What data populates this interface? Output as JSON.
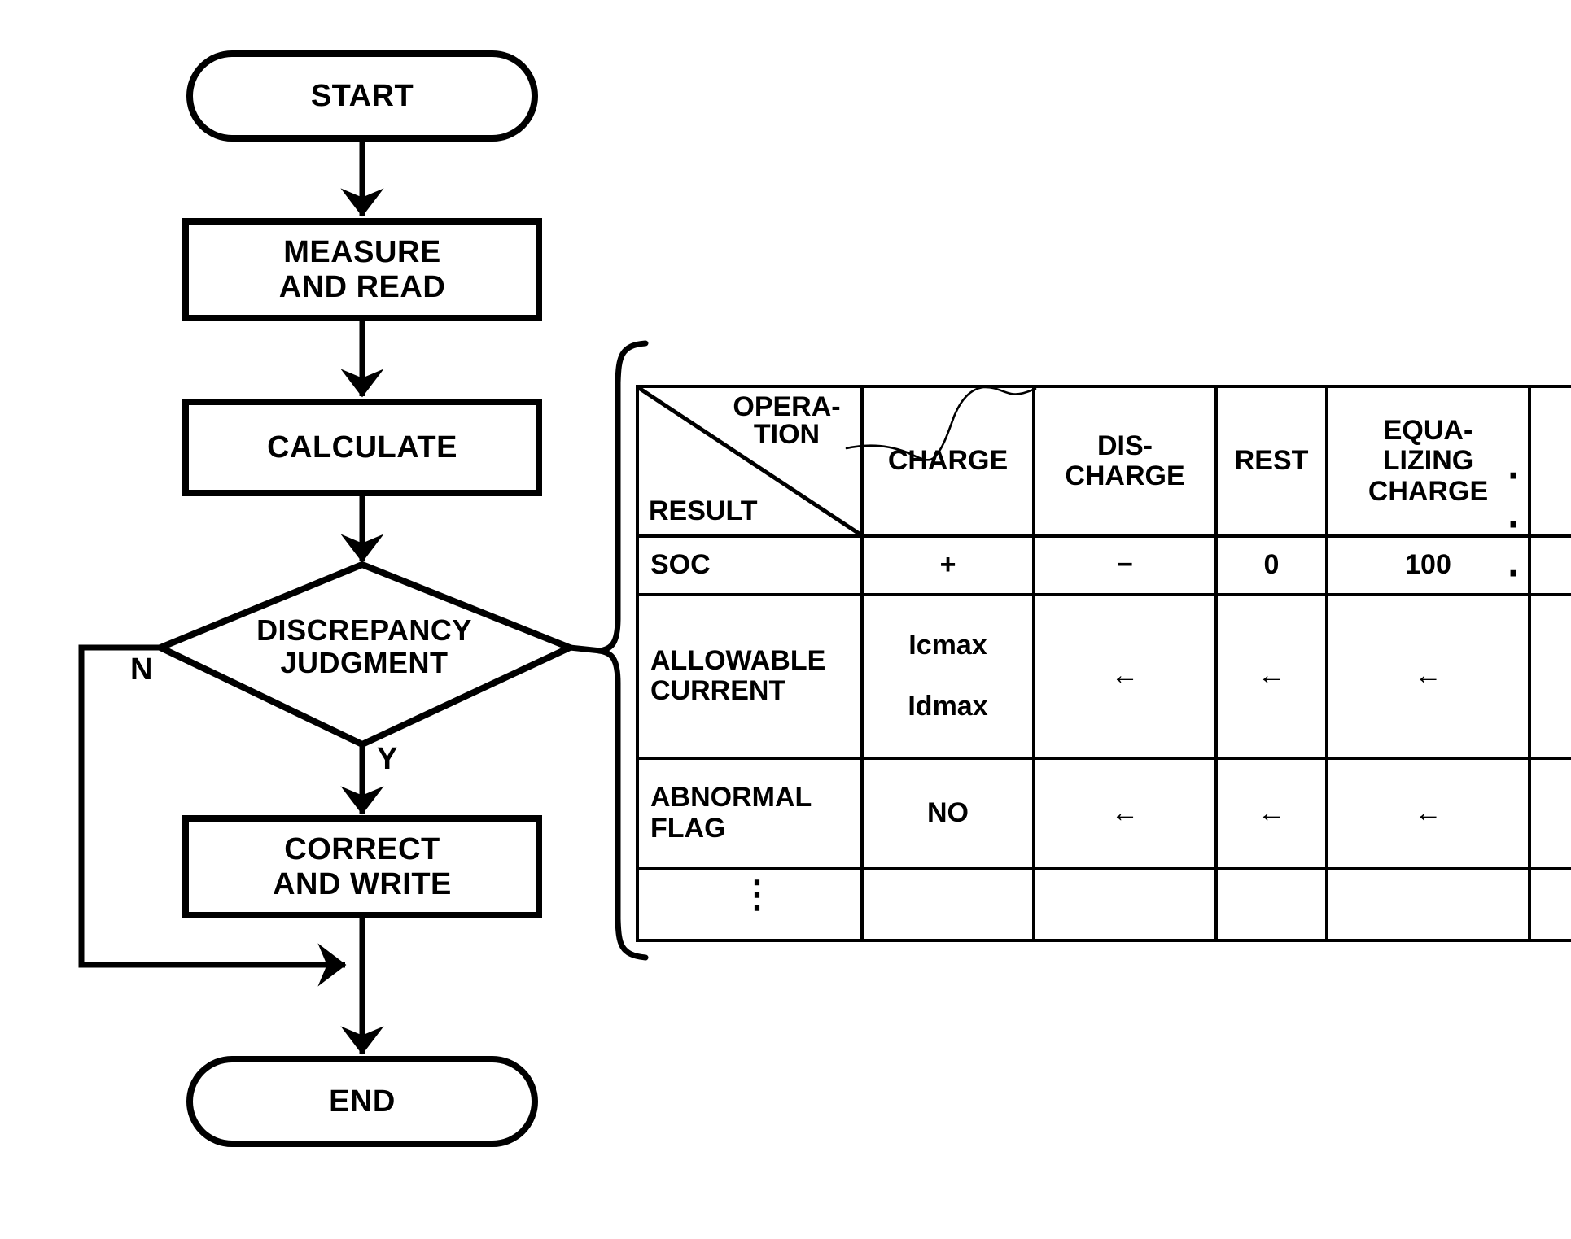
{
  "diagram": {
    "type": "flowchart-with-table",
    "flow": {
      "nodes": [
        {
          "id": "start",
          "shape": "terminal",
          "label": "START"
        },
        {
          "id": "measure",
          "shape": "process",
          "label": "MEASURE\nAND READ"
        },
        {
          "id": "calculate",
          "shape": "process",
          "label": "CALCULATE"
        },
        {
          "id": "judgment",
          "shape": "decision",
          "label": "DISCREPANCY\nJUDGMENT"
        },
        {
          "id": "correct",
          "shape": "process",
          "label": "CORRECT\nAND WRITE"
        },
        {
          "id": "end",
          "shape": "terminal",
          "label": "END"
        }
      ],
      "branch_labels": {
        "no": "N",
        "yes": "Y"
      }
    },
    "table": {
      "corner": {
        "column_axis_label": "OPERA-\nTION",
        "row_axis_label": "RESULT"
      },
      "columns": [
        {
          "key": "charge",
          "label": "CHARGE"
        },
        {
          "key": "dis",
          "label": "DIS-\nCHARGE"
        },
        {
          "key": "rest",
          "label": "REST"
        },
        {
          "key": "equal",
          "label": "EQUA-\nLIZING\nCHARGE"
        },
        {
          "key": "more",
          "label": ""
        }
      ],
      "columns_continuation": "· · ·",
      "rows": [
        {
          "label": "SOC",
          "cells": [
            "+",
            "−",
            "0",
            "100",
            ""
          ]
        },
        {
          "label": "ALLOWABLE\nCURRENT",
          "cells": [
            "Icmax\n\nIdmax",
            "←",
            "←",
            "←",
            ""
          ]
        },
        {
          "label": "ABNORMAL\nFLAG",
          "cells": [
            "NO",
            "←",
            "←",
            "←",
            ""
          ]
        },
        {
          "label": "",
          "cells": [
            "",
            "",
            "",
            "",
            ""
          ]
        }
      ],
      "rows_continuation": "⋮"
    },
    "colors": {
      "ink": "#000000",
      "background": "#ffffff"
    }
  }
}
